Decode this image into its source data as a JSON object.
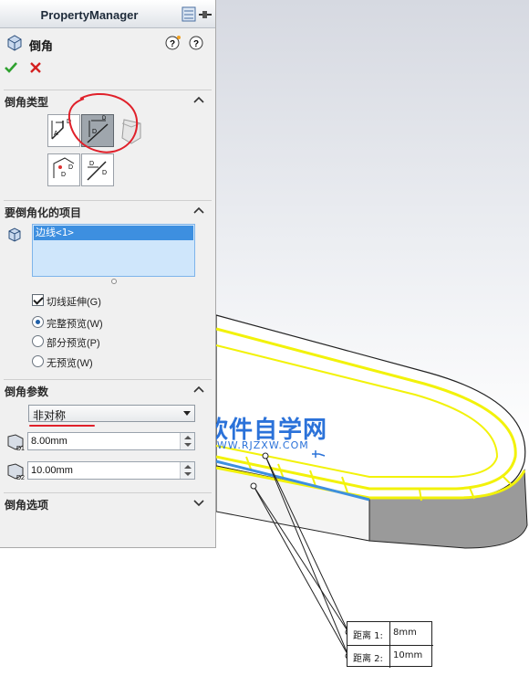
{
  "panel": {
    "title": "PropertyManager",
    "feature_name": "倒角",
    "ok_icon": "checkmark-icon",
    "cancel_icon": "x-icon"
  },
  "groups": {
    "chamfer_type": {
      "label": "倒角类型"
    },
    "items": {
      "label": "要倒角化的项目",
      "selected_item": "边线<1>"
    },
    "options": [
      {
        "label": "切线延伸(G)",
        "checked": true
      },
      {
        "label": "完整预览(W)",
        "selected": true
      },
      {
        "label": "部分预览(P)",
        "selected": false
      },
      {
        "label": "无预览(W)",
        "selected": false
      }
    ],
    "params": {
      "label": "倒角参数",
      "mode": "非对称",
      "distance1": "8.00mm",
      "distance2": "10.00mm"
    },
    "chamfer_options": {
      "label": "倒角选项"
    }
  },
  "watermark": {
    "title": "软件自学网",
    "url": "WWW.RJZXW.COM"
  },
  "callout": {
    "rows": [
      {
        "key": "距离 1:",
        "value": "8mm"
      },
      {
        "key": "距离 2:",
        "value": "10mm"
      }
    ]
  },
  "colors": {
    "accent_blue": "#3d8fe0",
    "highlight_yellow": "#f2f20a",
    "annotation_red": "#e0202a"
  }
}
